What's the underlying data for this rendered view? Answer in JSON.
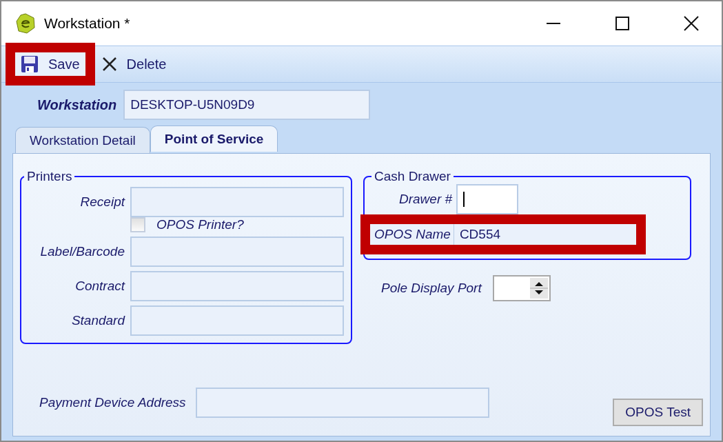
{
  "window": {
    "title": "Workstation *"
  },
  "toolbar": [
    {
      "kind": "save",
      "label": "Save",
      "highlighted": true
    },
    {
      "kind": "delete",
      "label": "Delete",
      "highlighted": false
    }
  ],
  "workstation": {
    "label": "Workstation",
    "value": "DESKTOP-U5N09D9"
  },
  "tabs": [
    {
      "label": "Workstation Detail",
      "selected": false
    },
    {
      "label": "Point of Service",
      "selected": true
    }
  ],
  "printers": {
    "title": "Printers",
    "rows": [
      {
        "kind": "field",
        "label": "Receipt"
      },
      {
        "kind": "checkbox",
        "label": "OPOS Printer?",
        "checked": false
      },
      {
        "kind": "field",
        "label": "Label/Barcode"
      },
      {
        "kind": "field",
        "label": "Contract"
      },
      {
        "kind": "field",
        "label": "Standard"
      }
    ]
  },
  "cash_drawer": {
    "title": "Cash Drawer",
    "drawer": {
      "label": "Drawer #",
      "focused": true
    },
    "opos_name": {
      "label": "OPOS Name",
      "value": "CD554",
      "highlighted": true
    }
  },
  "pole_display_port": {
    "label": "Pole Display Port"
  },
  "payment_device_address": {
    "label": "Payment Device Address"
  },
  "buttons": [
    {
      "label": "OPOS Test"
    }
  ]
}
